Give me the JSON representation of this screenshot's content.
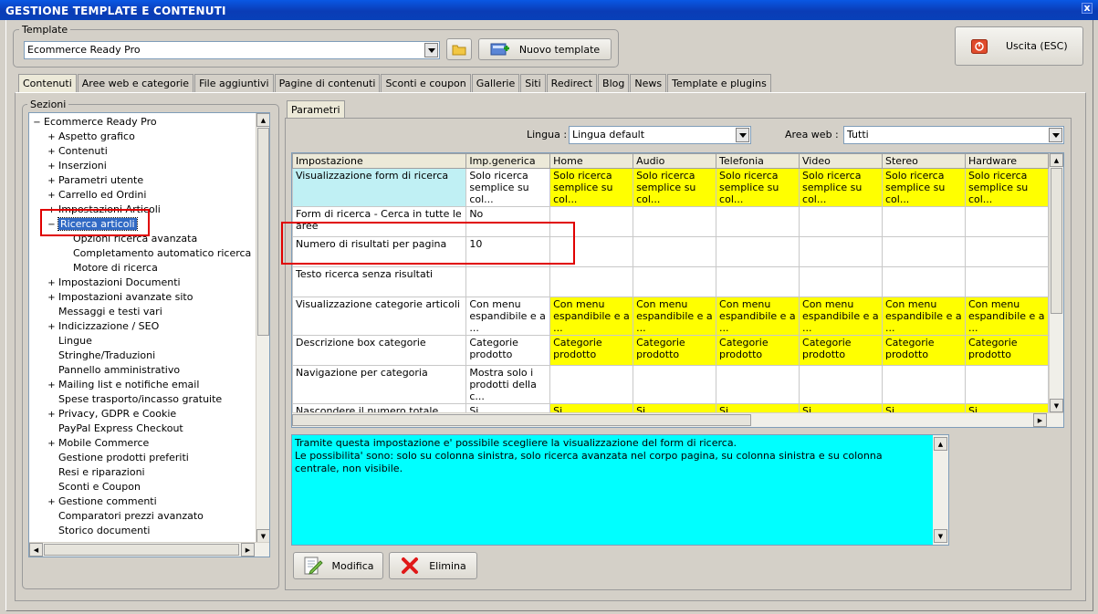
{
  "window": {
    "title": "GESTIONE TEMPLATE E CONTENUTI",
    "close": "x"
  },
  "template_group": {
    "label": "Template",
    "selected": "Ecommerce Ready Pro",
    "new_button": "Nuovo template",
    "exit_button": "Uscita (ESC)"
  },
  "tabs": [
    "Contenuti",
    "Aree web e categorie",
    "File aggiuntivi",
    "Pagine di contenuti",
    "Sconti e coupon",
    "Gallerie",
    "Siti",
    "Redirect",
    "Blog",
    "News",
    "Template e plugins"
  ],
  "sections": {
    "label": "Sezioni",
    "items": [
      {
        "label": "Ecommerce Ready Pro",
        "level": 0,
        "exp": "−"
      },
      {
        "label": "Aspetto grafico",
        "level": 1,
        "exp": "+"
      },
      {
        "label": "Contenuti",
        "level": 1,
        "exp": "+"
      },
      {
        "label": "Inserzioni",
        "level": 1,
        "exp": "+"
      },
      {
        "label": "Parametri utente",
        "level": 1,
        "exp": "+"
      },
      {
        "label": "Carrello ed Ordini",
        "level": 1,
        "exp": "+"
      },
      {
        "label": "Impostazioni Articoli",
        "level": 1,
        "exp": "+"
      },
      {
        "label": "Ricerca articoli",
        "level": 1,
        "exp": "−",
        "selected": true
      },
      {
        "label": "Opzioni ricerca avanzata",
        "level": 2,
        "exp": ""
      },
      {
        "label": "Completamento automatico ricerca",
        "level": 2,
        "exp": ""
      },
      {
        "label": "Motore di ricerca",
        "level": 2,
        "exp": ""
      },
      {
        "label": "Impostazioni Documenti",
        "level": 1,
        "exp": "+"
      },
      {
        "label": "Impostazioni avanzate sito",
        "level": 1,
        "exp": "+"
      },
      {
        "label": "Messaggi e testi vari",
        "level": 1,
        "exp": ""
      },
      {
        "label": "Indicizzazione / SEO",
        "level": 1,
        "exp": "+"
      },
      {
        "label": "Lingue",
        "level": 1,
        "exp": ""
      },
      {
        "label": "Stringhe/Traduzioni",
        "level": 1,
        "exp": ""
      },
      {
        "label": "Pannello amministrativo",
        "level": 1,
        "exp": ""
      },
      {
        "label": "Mailing list e notifiche email",
        "level": 1,
        "exp": "+"
      },
      {
        "label": "Spese trasporto/incasso gratuite",
        "level": 1,
        "exp": ""
      },
      {
        "label": "Privacy, GDPR e Cookie",
        "level": 1,
        "exp": "+"
      },
      {
        "label": "PayPal Express Checkout",
        "level": 1,
        "exp": ""
      },
      {
        "label": "Mobile Commerce",
        "level": 1,
        "exp": "+"
      },
      {
        "label": "Gestione prodotti preferiti",
        "level": 1,
        "exp": ""
      },
      {
        "label": "Resi e riparazioni",
        "level": 1,
        "exp": ""
      },
      {
        "label": "Sconti e Coupon",
        "level": 1,
        "exp": ""
      },
      {
        "label": "Gestione commenti",
        "level": 1,
        "exp": "+"
      },
      {
        "label": "Comparatori prezzi avanzato",
        "level": 1,
        "exp": ""
      },
      {
        "label": "Storico documenti",
        "level": 1,
        "exp": ""
      }
    ]
  },
  "params": {
    "tab": "Parametri",
    "lingua_label": "Lingua :",
    "lingua_value": "Lingua default",
    "area_label": "Area web :",
    "area_value": "Tutti",
    "columns": [
      "Impostazione",
      "Imp.generica",
      "Home",
      "Audio",
      "Telefonia",
      "Video",
      "Stereo",
      "Hardware"
    ],
    "rows": [
      {
        "name": "Visualizzazione form di ricerca",
        "generic": "Solo ricerca semplice su col...",
        "val": "Solo ricerca semplice su col...",
        "hl": "yellow",
        "sel": true
      },
      {
        "name": "Form di ricerca - Cerca in tutte le aree",
        "generic": "No",
        "val": "",
        "hl": ""
      },
      {
        "name": "Numero di risultati per pagina",
        "generic": "10",
        "val": "",
        "hl": ""
      },
      {
        "name": "Testo ricerca senza risultati",
        "generic": "",
        "val": "",
        "hl": ""
      },
      {
        "name": "Visualizzazione categorie articoli",
        "generic": "Con menu espandibile e a ...",
        "val": "Con menu espandibile e a ...",
        "hl": "yellow"
      },
      {
        "name": "Descrizione box categorie",
        "generic": "Categorie prodotto",
        "val": "Categorie prodotto",
        "hl": "yellow"
      },
      {
        "name": "Navigazione per categoria",
        "generic": "Mostra solo i prodotti della c...",
        "val": "",
        "hl": ""
      },
      {
        "name": "Nascondere il numero totale articoli su ogni ramo dell'albero categorie?",
        "generic": "Si",
        "val": "Si",
        "hl": "yellow"
      }
    ],
    "description": "Tramite questa impostazione e' possibile scegliere la visualizzazione del form di ricerca.\nLe possibilita' sono: solo su colonna sinistra, solo ricerca avanzata nel corpo pagina, su colonna sinistra e su colonna centrale, non visibile.",
    "edit_button": "Modifica",
    "delete_button": "Elimina"
  },
  "colors": {
    "highlight": "#ffff00",
    "description_bg": "#00ffff",
    "selection": "#316ac5",
    "annotation": "#e00000"
  }
}
